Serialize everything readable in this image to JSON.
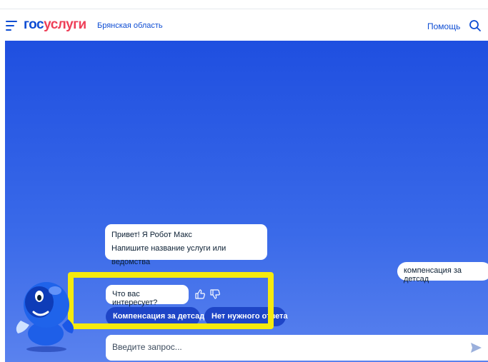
{
  "header": {
    "logo_part1": "гос",
    "logo_part2": "услуги",
    "region": "Брянская область",
    "help": "Помощь"
  },
  "chat": {
    "greeting_line1": "Привет! Я Робот Макс",
    "greeting_line2": "Напишите название услуги или ведомства",
    "user_message": "компенсация за детсад",
    "question": "Что вас интересует?",
    "options": [
      "Компенсация за детсад",
      "Нет нужного ответа"
    ]
  },
  "input": {
    "placeholder": "Введите запрос..."
  },
  "colors": {
    "brand_blue": "#0d4cd3",
    "brand_red": "#ee3f58",
    "highlight": "#f5ea0e"
  }
}
